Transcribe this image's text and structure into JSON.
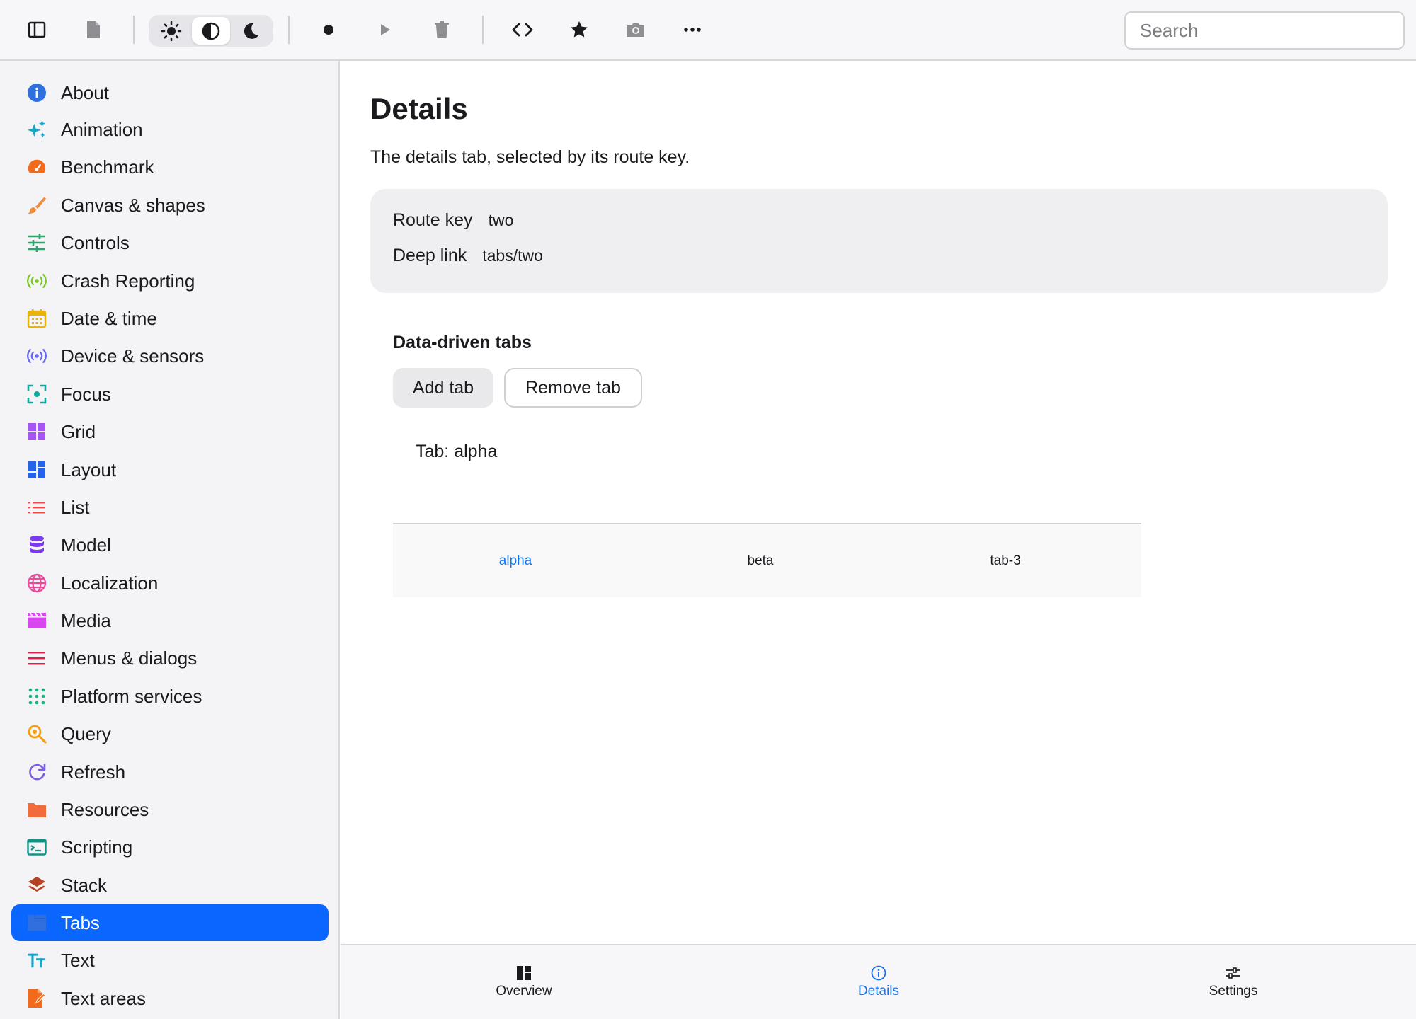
{
  "toolbar": {
    "icons": [
      "sidebar-toggle-icon",
      "document-icon",
      "sun-icon",
      "contrast-icon",
      "moon-icon",
      "record-icon",
      "play-icon",
      "trash-icon",
      "code-icon",
      "star-icon",
      "camera-icon",
      "more-icon"
    ],
    "theme_selected": "contrast",
    "search_placeholder": "Search",
    "search_value": ""
  },
  "sidebar": {
    "items": [
      {
        "label": "About",
        "icon": "info-icon",
        "color": "#2f6fde"
      },
      {
        "label": "Animation",
        "icon": "sparkles-icon",
        "color": "#1aa6c8"
      },
      {
        "label": "Benchmark",
        "icon": "gauge-icon",
        "color": "#f26b1d"
      },
      {
        "label": "Canvas & shapes",
        "icon": "brush-icon",
        "color": "#f28c38"
      },
      {
        "label": "Controls",
        "icon": "sliders-icon",
        "color": "#2ea36b"
      },
      {
        "label": "Crash Reporting",
        "icon": "broadcast-icon",
        "color": "#7cc627"
      },
      {
        "label": "Date & time",
        "icon": "calendar-icon",
        "color": "#eab308"
      },
      {
        "label": "Device & sensors",
        "icon": "sensor-icon",
        "color": "#6366f1"
      },
      {
        "label": "Focus",
        "icon": "focus-icon",
        "color": "#14a8a0"
      },
      {
        "label": "Grid",
        "icon": "grid-icon",
        "color": "#a855f7"
      },
      {
        "label": "Layout",
        "icon": "layout-icon",
        "color": "#2563eb"
      },
      {
        "label": "List",
        "icon": "list-icon",
        "color": "#ef4444"
      },
      {
        "label": "Model",
        "icon": "database-icon",
        "color": "#7c3aed"
      },
      {
        "label": "Localization",
        "icon": "globe-icon",
        "color": "#ec4899"
      },
      {
        "label": "Media",
        "icon": "clapperboard-icon",
        "color": "#d946ef"
      },
      {
        "label": "Menus & dialogs",
        "icon": "menu-icon",
        "color": "#e11d48"
      },
      {
        "label": "Platform services",
        "icon": "dots-grid-icon",
        "color": "#10b981"
      },
      {
        "label": "Query",
        "icon": "search-icon",
        "color": "#f59e0b"
      },
      {
        "label": "Refresh",
        "icon": "refresh-icon",
        "color": "#7c5ce0"
      },
      {
        "label": "Resources",
        "icon": "folder-icon",
        "color": "#f26b3a"
      },
      {
        "label": "Scripting",
        "icon": "terminal-icon",
        "color": "#0f9488"
      },
      {
        "label": "Stack",
        "icon": "layers-icon",
        "color": "#b4411f"
      },
      {
        "label": "Tabs",
        "icon": "tabs-icon",
        "color": "#2f6fde",
        "selected": true
      },
      {
        "label": "Text",
        "icon": "text-icon",
        "color": "#1aa6c8"
      },
      {
        "label": "Text areas",
        "icon": "edit-document-icon",
        "color": "#f26b1d"
      }
    ]
  },
  "main": {
    "title": "Details",
    "description": "The details tab, selected by its route key.",
    "info": {
      "route_key_label": "Route key",
      "route_key_value": "two",
      "deep_link_label": "Deep link",
      "deep_link_value": "tabs/two"
    },
    "section_title": "Data-driven tabs",
    "add_tab_label": "Add tab",
    "remove_tab_label": "Remove tab",
    "tab_content": "Tab: alpha",
    "inner_tabs": [
      "alpha",
      "beta",
      "tab-3"
    ],
    "inner_tab_active": "alpha"
  },
  "bottom_tabs": [
    {
      "label": "Overview",
      "icon": "dashboard-icon"
    },
    {
      "label": "Details",
      "icon": "info-icon",
      "active": true
    },
    {
      "label": "Settings",
      "icon": "settings-sliders-icon"
    }
  ],
  "colors": {
    "accent": "#0a66ff",
    "link": "#1a73e8",
    "sidebar_bg": "#f4f4f7",
    "card_bg": "#efeff1"
  }
}
